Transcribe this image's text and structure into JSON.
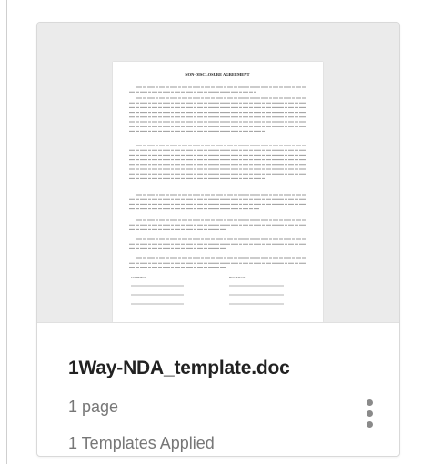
{
  "card": {
    "filename": "1Way-NDA_template.doc",
    "page_count": "1 page",
    "templates_applied": "1 Templates Applied",
    "menu_icon": "vertical-ellipsis-icon"
  },
  "thumbnail": {
    "doc_title": "NON-DISCLOSURE AGREEMENT",
    "signature_left": "COMPANY",
    "signature_right": "RECIPIENT"
  },
  "colors": {
    "thumb_background": "#ebebeb",
    "filename_text": "#222222",
    "meta_text": "#777777",
    "menu_dots": "#8a8a8a"
  }
}
